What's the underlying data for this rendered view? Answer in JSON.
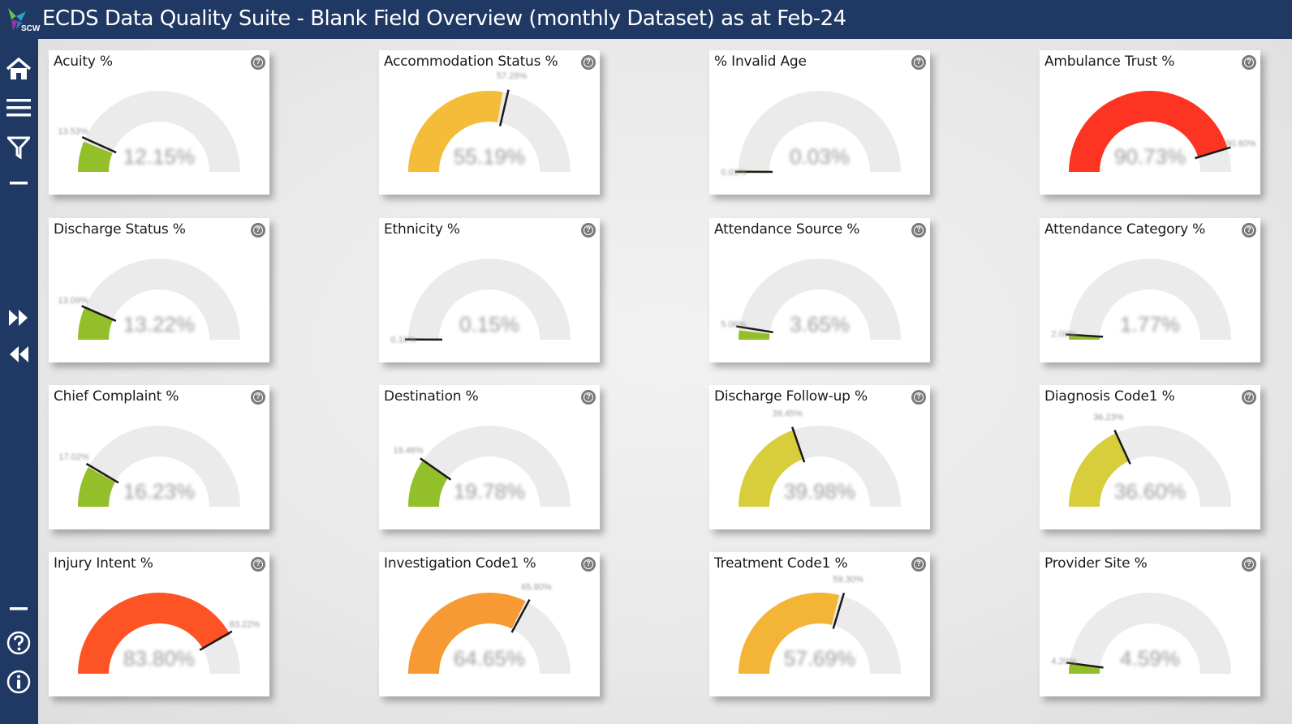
{
  "header": {
    "title": "ECDS Data Quality Suite - Blank Field Overview (monthly Dataset) as at Feb-24",
    "logo_text": "SCW"
  },
  "sidebar": {
    "buttons": [
      {
        "name": "home-icon"
      },
      {
        "name": "menu-icon"
      },
      {
        "name": "filter-icon"
      },
      {
        "name": "minus-icon"
      },
      {
        "name": "expand-icon"
      },
      {
        "name": "collapse-icon"
      },
      {
        "name": "minus-icon"
      },
      {
        "name": "help-icon"
      },
      {
        "name": "info-icon"
      }
    ]
  },
  "colors": {
    "header_bg": "#1f3864",
    "gauge_track": "#ebebeb",
    "target_marker": "#1a1a1a"
  },
  "cards": [
    {
      "title": "Acuity %",
      "value": "12.15%",
      "target": "13.53%",
      "pct": 12.15,
      "target_pct": 13.53,
      "color": "#93bf2a"
    },
    {
      "title": "Accommodation Status %",
      "value": "55.19%",
      "target": "57.28%",
      "pct": 55.19,
      "target_pct": 57.28,
      "color": "#f4bc38"
    },
    {
      "title": "% Invalid Age",
      "value": "0.03%",
      "target": "0.03%",
      "pct": 0.03,
      "target_pct": 0.03,
      "color": "#93bf2a"
    },
    {
      "title": "Ambulance Trust %",
      "value": "90.73%",
      "target": "90.60%",
      "pct": 90.73,
      "target_pct": 90.6,
      "color": "#fd3422"
    },
    {
      "title": "Discharge Status %",
      "value": "13.22%",
      "target": "13.09%",
      "pct": 13.22,
      "target_pct": 13.09,
      "color": "#93bf2a"
    },
    {
      "title": "Ethnicity %",
      "value": "0.15%",
      "target": "0.10%",
      "pct": 0.15,
      "target_pct": 0.1,
      "color": "#93bf2a"
    },
    {
      "title": "Attendance Source %",
      "value": "3.65%",
      "target": "5.06%",
      "pct": 3.65,
      "target_pct": 5.06,
      "color": "#93bf2a"
    },
    {
      "title": "Attendance Category %",
      "value": "1.77%",
      "target": "2.00%",
      "pct": 1.77,
      "target_pct": 2.0,
      "color": "#93bf2a"
    },
    {
      "title": "Chief Complaint %",
      "value": "16.23%",
      "target": "17.02%",
      "pct": 16.23,
      "target_pct": 17.02,
      "color": "#93bf2a"
    },
    {
      "title": "Destination %",
      "value": "19.78%",
      "target": "19.46%",
      "pct": 19.78,
      "target_pct": 19.46,
      "color": "#93bf2a"
    },
    {
      "title": "Discharge Follow-up %",
      "value": "39.98%",
      "target": "39.45%",
      "pct": 39.98,
      "target_pct": 39.45,
      "color": "#d8cd3a"
    },
    {
      "title": "Diagnosis Code1 %",
      "value": "36.60%",
      "target": "36.23%",
      "pct": 36.6,
      "target_pct": 36.23,
      "color": "#d8cd3a"
    },
    {
      "title": "Injury Intent %",
      "value": "83.80%",
      "target": "83.22%",
      "pct": 83.8,
      "target_pct": 83.22,
      "color": "#fd5325"
    },
    {
      "title": "Investigation Code1 %",
      "value": "64.65%",
      "target": "65.80%",
      "pct": 64.65,
      "target_pct": 65.8,
      "color": "#f79a33"
    },
    {
      "title": "Treatment Code1 %",
      "value": "57.69%",
      "target": "59.30%",
      "pct": 57.69,
      "target_pct": 59.3,
      "color": "#f4b536"
    },
    {
      "title": "Provider Site %",
      "value": "4.59%",
      "target": "4.20%",
      "pct": 4.59,
      "target_pct": 4.2,
      "color": "#93bf2a"
    }
  ]
}
